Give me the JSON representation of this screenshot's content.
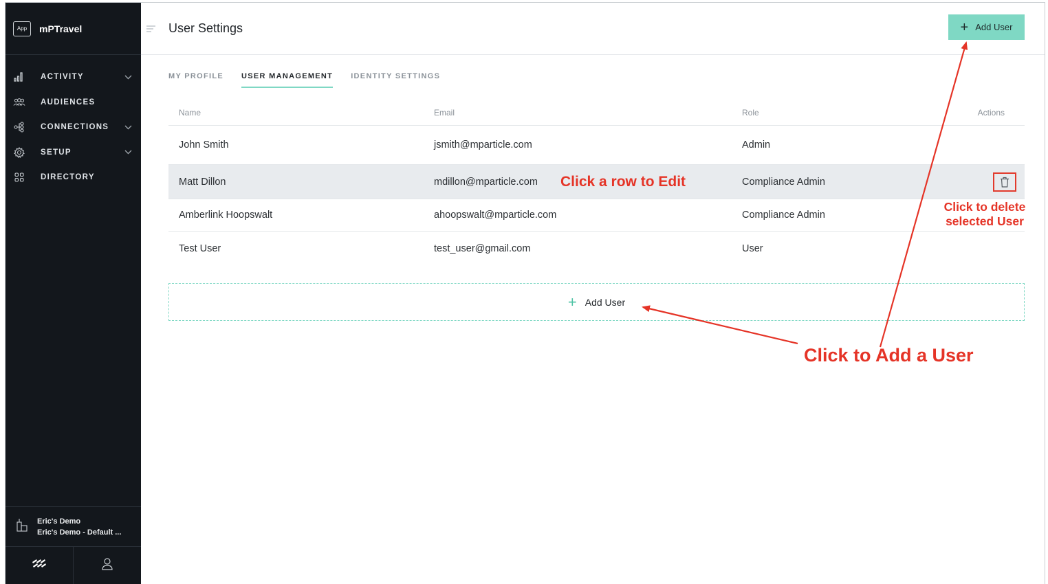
{
  "brand": {
    "badge": "App",
    "name": "mPTravel"
  },
  "sidebar": {
    "items": [
      {
        "label": "ACTIVITY",
        "icon": "bar-chart-icon",
        "has_chevron": true
      },
      {
        "label": "AUDIENCES",
        "icon": "people-icon",
        "has_chevron": false
      },
      {
        "label": "CONNECTIONS",
        "icon": "connections-icon",
        "has_chevron": true
      },
      {
        "label": "SETUP",
        "icon": "gear-icon",
        "has_chevron": true
      },
      {
        "label": "DIRECTORY",
        "icon": "grid-icon",
        "has_chevron": false
      }
    ],
    "workspace": {
      "org": "Eric's Demo",
      "workspace": "Eric's Demo - Default ..."
    }
  },
  "header": {
    "title": "User Settings",
    "add_user_label": "Add User"
  },
  "tabs": [
    {
      "label": "MY PROFILE",
      "active": false
    },
    {
      "label": "USER MANAGEMENT",
      "active": true
    },
    {
      "label": "IDENTITY SETTINGS",
      "active": false
    }
  ],
  "table": {
    "columns": {
      "name": "Name",
      "email": "Email",
      "role": "Role",
      "actions": "Actions"
    },
    "rows": [
      {
        "name": "John Smith",
        "email": "jsmith@mparticle.com",
        "role": "Admin"
      },
      {
        "name": "Matt Dillon",
        "email": "mdillon@mparticle.com",
        "role": "Compliance Admin",
        "selected": true
      },
      {
        "name": "Amberlink Hoopswalt",
        "email": "ahoopswalt@mparticle.com",
        "role": "Compliance Admin"
      },
      {
        "name": "Test User",
        "email": "test_user@gmail.com",
        "role": "User"
      }
    ]
  },
  "add_user_row": {
    "label": "Add User"
  },
  "annotations": {
    "edit": "Click a row to Edit",
    "delete_line1": "Click to delete",
    "delete_line2": "selected  User",
    "add": "Click to Add a User"
  },
  "colors": {
    "sidebar_bg": "#13171c",
    "accent": "#7fd8c4",
    "annotation": "#e53427",
    "selected_row": "#e8ebee"
  }
}
